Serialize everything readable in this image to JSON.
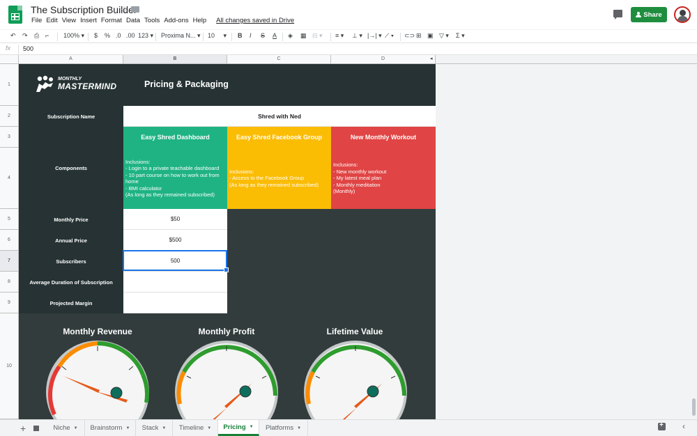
{
  "app": {
    "title": "The Subscription Builder",
    "save_status": "All changes saved in Drive",
    "share_label": "Share",
    "menu": [
      "File",
      "Edit",
      "View",
      "Insert",
      "Format",
      "Data",
      "Tools",
      "Add-ons",
      "Help"
    ]
  },
  "toolbar": {
    "zoom": "100%",
    "currency": "$",
    "percent": "%",
    "dec_less": ".0",
    "dec_more": ".00",
    "number_format": "123",
    "font": "Proxima N...",
    "font_size": "10",
    "bold": "B",
    "italic": "I",
    "strike": "S",
    "text_color": "A"
  },
  "formula_bar": {
    "fx": "fx",
    "value": "500"
  },
  "columns": [
    "A",
    "B",
    "C",
    "D"
  ],
  "rows": [
    "1",
    "2",
    "3",
    "4",
    "5",
    "6",
    "7",
    "8",
    "9",
    "10"
  ],
  "sheet": {
    "logo_top": "MONTHLY",
    "logo_bottom": "MASTERMIND",
    "header_title": "Pricing & Packaging",
    "subscription_label": "Subscription Name",
    "subscription_value": "Shred with Ned",
    "components_label": "Components",
    "components": [
      {
        "title": "Easy Shred Dashboard",
        "color": "#1fb383",
        "lines": [
          "Inclusions:",
          "- Login to a private teachable dashboard",
          "- 10 part course on how to work out from home",
          "- BMI calculator",
          "(As long as they remained subscribed)"
        ]
      },
      {
        "title": "Easy Shred Facebook Group",
        "color": "#fbbc04",
        "lines": [
          "Inclusions:",
          "- Access to the Facebook Group",
          "(As long as they remained subscribed)"
        ]
      },
      {
        "title": "New Monthly Workout",
        "color": "#e04444",
        "lines": [
          "Inclusions:",
          "- New monthly workout",
          "- My latest meal plan",
          "- Monthly meditation",
          "(Monthly)"
        ]
      }
    ],
    "rows": [
      {
        "label": "Monthly Price",
        "value": "$50"
      },
      {
        "label": "Annual Price",
        "value": "$500"
      },
      {
        "label": "Subscribers",
        "value": "500"
      },
      {
        "label": "Average Duration of Subscription",
        "value": ""
      },
      {
        "label": "Projected Margin",
        "value": ""
      }
    ]
  },
  "gauges": [
    {
      "title": "Monthly Revenue"
    },
    {
      "title": "Monthly Profit"
    },
    {
      "title": "Lifetime Value"
    }
  ],
  "colors": {
    "dark_bg": "#263233",
    "selection": "#1a73e8",
    "active_tab": "#188038"
  },
  "tabs": [
    {
      "label": "Niche",
      "active": false
    },
    {
      "label": "Brainstorm",
      "active": false
    },
    {
      "label": "Stack",
      "active": false
    },
    {
      "label": "Timeline",
      "active": false
    },
    {
      "label": "Pricing",
      "active": true
    },
    {
      "label": "Platforms",
      "active": false
    }
  ]
}
